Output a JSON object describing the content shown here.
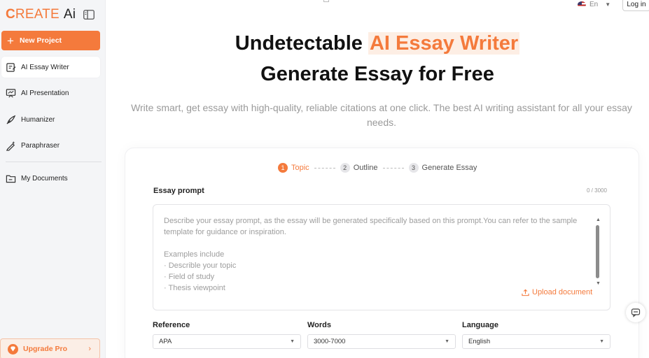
{
  "brand": {
    "logo_c": "C",
    "logo_reate": "REATE",
    "logo_ai": "Ai",
    "accent": "#f47a3c"
  },
  "sidebar": {
    "new_project": "New Project",
    "items": [
      {
        "label": "AI Essay Writer",
        "icon": "essay-icon",
        "active": true
      },
      {
        "label": "AI Presentation",
        "icon": "presentation-icon",
        "active": false
      },
      {
        "label": "Humanizer",
        "icon": "humanizer-icon",
        "active": false
      },
      {
        "label": "Paraphraser",
        "icon": "paraphraser-icon",
        "active": false
      },
      {
        "label": "My Documents",
        "icon": "folder-icon",
        "active": false
      }
    ],
    "upgrade": "Upgrade Pro"
  },
  "header": {
    "language": "En",
    "login": "Log in"
  },
  "hero": {
    "line1_prefix": "Undetectable ",
    "line1_highlight": "AI Essay Writer",
    "line2": "Generate Essay for Free",
    "subtitle": "Write smart, get essay with high-quality, reliable citations at one click. The best AI writing assistant for all your essay needs."
  },
  "steps": [
    {
      "num": "1",
      "label": "Topic",
      "active": true
    },
    {
      "num": "2",
      "label": "Outline",
      "active": false
    },
    {
      "num": "3",
      "label": "Generate Essay",
      "active": false
    }
  ],
  "prompt": {
    "label": "Essay prompt",
    "counter": "0 / 3000",
    "placeholder": "Describe your essay prompt, as the essay will be generated specifically based on this prompt.You can refer to the sample template for guidance or inspiration.\n\nExamples include\n· Describle your topic\n· Field of study\n· Thesis viewpoint",
    "upload": "Upload document"
  },
  "options": {
    "reference_label": "Reference",
    "reference_value": "APA",
    "words_label": "Words",
    "words_value": "3000-7000",
    "language_label": "Language",
    "language_value": "English"
  }
}
